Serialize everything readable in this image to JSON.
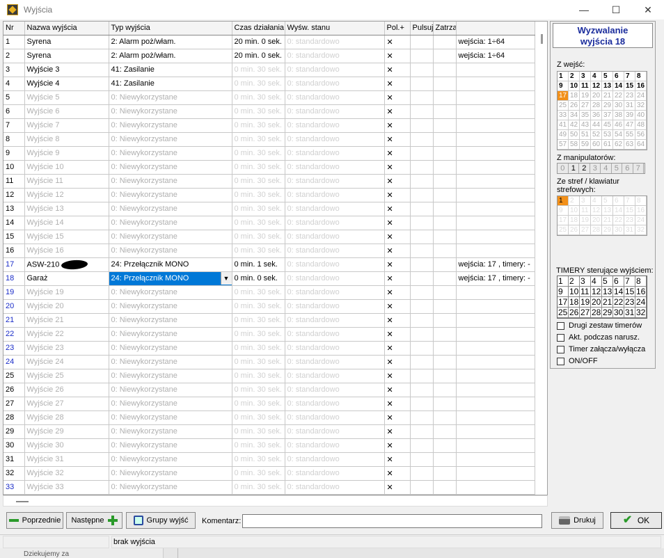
{
  "window": {
    "title": "Wyjścia",
    "minimize": "—",
    "maximize": "☐",
    "close": "✕"
  },
  "columns": [
    "Nr",
    "Nazwa wyjścia",
    "Typ wyjścia",
    "Czas działania",
    "Wyśw. stanu",
    "Pol.+",
    "Pulsuj",
    "Zatrza",
    ""
  ],
  "rows": [
    {
      "nr": "1",
      "name": "Syrena",
      "type": "2: Alarm poż/włam.",
      "time": "20 min. 0  sek.",
      "disp": "0: standardowo",
      "x": "✕",
      "info": "wejścia: 1÷64",
      "active": true
    },
    {
      "nr": "2",
      "name": "Syrena",
      "type": "2: Alarm poż/włam.",
      "time": "20 min. 0  sek.",
      "disp": "0: standardowo",
      "x": "✕",
      "info": "wejścia: 1÷64",
      "active": true
    },
    {
      "nr": "3",
      "name": "Wyjście 3",
      "type": "41: Zasilanie",
      "time": "0  min. 30 sek.",
      "disp": "0: standardowo",
      "x": "✕",
      "info": "",
      "active": true,
      "timegray": true
    },
    {
      "nr": "4",
      "name": "Wyjście 4",
      "type": "41: Zasilanie",
      "time": "0  min. 30 sek.",
      "disp": "0: standardowo",
      "x": "✕",
      "info": "",
      "active": true,
      "timegray": true
    },
    {
      "nr": "5",
      "name": "Wyjście  5",
      "type": "0: Niewykorzystane",
      "time": "0  min. 30 sek.",
      "disp": "0: standardowo",
      "x": "✕",
      "info": ""
    },
    {
      "nr": "6",
      "name": "Wyjście  6",
      "type": "0: Niewykorzystane",
      "time": "0  min. 30 sek.",
      "disp": "0: standardowo",
      "x": "✕",
      "info": ""
    },
    {
      "nr": "7",
      "name": "Wyjście  7",
      "type": "0: Niewykorzystane",
      "time": "0  min. 30 sek.",
      "disp": "0: standardowo",
      "x": "✕",
      "info": ""
    },
    {
      "nr": "8",
      "name": "Wyjście  8",
      "type": "0: Niewykorzystane",
      "time": "0  min. 30 sek.",
      "disp": "0: standardowo",
      "x": "✕",
      "info": ""
    },
    {
      "nr": "9",
      "name": "Wyjście  9",
      "type": "0: Niewykorzystane",
      "time": "0  min. 30 sek.",
      "disp": "0: standardowo",
      "x": "✕",
      "info": ""
    },
    {
      "nr": "10",
      "name": "Wyjście  10",
      "type": "0: Niewykorzystane",
      "time": "0  min. 30 sek.",
      "disp": "0: standardowo",
      "x": "✕",
      "info": ""
    },
    {
      "nr": "11",
      "name": "Wyjście  11",
      "type": "0: Niewykorzystane",
      "time": "0  min. 30 sek.",
      "disp": "0: standardowo",
      "x": "✕",
      "info": ""
    },
    {
      "nr": "12",
      "name": "Wyjście  12",
      "type": "0: Niewykorzystane",
      "time": "0  min. 30 sek.",
      "disp": "0: standardowo",
      "x": "✕",
      "info": ""
    },
    {
      "nr": "13",
      "name": "Wyjście  13",
      "type": "0: Niewykorzystane",
      "time": "0  min. 30 sek.",
      "disp": "0: standardowo",
      "x": "✕",
      "info": ""
    },
    {
      "nr": "14",
      "name": "Wyjście  14",
      "type": "0: Niewykorzystane",
      "time": "0  min. 30 sek.",
      "disp": "0: standardowo",
      "x": "✕",
      "info": ""
    },
    {
      "nr": "15",
      "name": "Wyjście  15",
      "type": "0: Niewykorzystane",
      "time": "0  min. 30 sek.",
      "disp": "0: standardowo",
      "x": "✕",
      "info": ""
    },
    {
      "nr": "16",
      "name": "Wyjście  16",
      "type": "0: Niewykorzystane",
      "time": "0  min. 30 sek.",
      "disp": "0: standardowo",
      "x": "✕",
      "info": ""
    },
    {
      "nr": "17",
      "name": "ASW-210",
      "type": "24: Przełącznik MONO",
      "time": "0  min. 1  sek.",
      "disp": "0: standardowo",
      "x": "✕",
      "info": "wejścia: 17 , timery: -",
      "active": true,
      "blue": true,
      "blob": true
    },
    {
      "nr": "18",
      "name": "Garaż",
      "type": "24: Przełącznik MONO",
      "time": "0  min. 0  sek.",
      "disp": "0: standardowo",
      "x": "✕",
      "info": "wejścia: 17 , timery: -",
      "active": true,
      "blue": true,
      "norm": true,
      "selected": true
    },
    {
      "nr": "19",
      "name": "Wyjście  19",
      "type": "0: Niewykorzystane",
      "time": "0  min. 30 sek.",
      "disp": "0: standardowo",
      "x": "✕",
      "info": "",
      "blue": true,
      "norm": true
    },
    {
      "nr": "20",
      "name": "Wyjście  20",
      "type": "0: Niewykorzystane",
      "time": "0  min. 30 sek.",
      "disp": "0: standardowo",
      "x": "✕",
      "info": "",
      "blue": true,
      "norm": true
    },
    {
      "nr": "21",
      "name": "Wyjście  21",
      "type": "0: Niewykorzystane",
      "time": "0  min. 30 sek.",
      "disp": "0: standardowo",
      "x": "✕",
      "info": "",
      "blue": true,
      "norm": true
    },
    {
      "nr": "22",
      "name": "Wyjście  22",
      "type": "0: Niewykorzystane",
      "time": "0  min. 30 sek.",
      "disp": "0: standardowo",
      "x": "✕",
      "info": "",
      "blue": true,
      "norm": true
    },
    {
      "nr": "23",
      "name": "Wyjście  23",
      "type": "0: Niewykorzystane",
      "time": "0  min. 30 sek.",
      "disp": "0: standardowo",
      "x": "✕",
      "info": "",
      "blue": true,
      "norm": true
    },
    {
      "nr": "24",
      "name": "Wyjście  24",
      "type": "0: Niewykorzystane",
      "time": "0  min. 30 sek.",
      "disp": "0: standardowo",
      "x": "✕",
      "info": "",
      "blue": true,
      "norm": true
    },
    {
      "nr": "25",
      "name": "Wyjście  25",
      "type": "0: Niewykorzystane",
      "time": "0  min. 30 sek.",
      "disp": "0: standardowo",
      "x": "✕",
      "info": "",
      "norm": true
    },
    {
      "nr": "26",
      "name": "Wyjście  26",
      "type": "0: Niewykorzystane",
      "time": "0  min. 30 sek.",
      "disp": "0: standardowo",
      "x": "✕",
      "info": "",
      "norm": true
    },
    {
      "nr": "27",
      "name": "Wyjście  27",
      "type": "0: Niewykorzystane",
      "time": "0  min. 30 sek.",
      "disp": "0: standardowo",
      "x": "✕",
      "info": "",
      "norm": true
    },
    {
      "nr": "28",
      "name": "Wyjście  28",
      "type": "0: Niewykorzystane",
      "time": "0  min. 30 sek.",
      "disp": "0: standardowo",
      "x": "✕",
      "info": "",
      "norm": true
    },
    {
      "nr": "29",
      "name": "Wyjście  29",
      "type": "0: Niewykorzystane",
      "time": "0  min. 30 sek.",
      "disp": "0: standardowo",
      "x": "✕",
      "info": "",
      "norm": true
    },
    {
      "nr": "30",
      "name": "Wyjście  30",
      "type": "0: Niewykorzystane",
      "time": "0  min. 30 sek.",
      "disp": "0: standardowo",
      "x": "✕",
      "info": "",
      "norm": true
    },
    {
      "nr": "31",
      "name": "Wyjście  31",
      "type": "0: Niewykorzystane",
      "time": "0  min. 30 sek.",
      "disp": "0: standardowo",
      "x": "✕",
      "info": "",
      "norm": true
    },
    {
      "nr": "32",
      "name": "Wyjście  32",
      "type": "0: Niewykorzystane",
      "time": "0  min. 30 sek.",
      "disp": "0: standardowo",
      "x": "✕",
      "info": "",
      "norm": true
    },
    {
      "nr": "33",
      "name": "Wyjście  33",
      "type": "0: Niewykorzystane",
      "time": "0  min. 30 sek.",
      "disp": "0: standardowo",
      "x": "✕",
      "info": "",
      "blue": true,
      "norm": true
    }
  ],
  "right_panel": {
    "title_line1": "Wyzwalanie",
    "title_line2": "wyjścia 18",
    "inputs_label": "Z wejść:",
    "inputs_selected": "17",
    "keypads_label": "Z manipulatorów:",
    "keypads": [
      "0",
      "1",
      "2",
      "3",
      "4",
      "5",
      "6",
      "7"
    ],
    "zones_label_line1": "Ze stref / klawiatur",
    "zones_label_line2": "strefowych:",
    "timers_label": "TIMERY sterujące wyjściem:",
    "checkboxes": [
      "Drugi zestaw timerów",
      "Akt. podczas narusz.",
      "Timer załącza/wyłącza",
      "ON/OFF"
    ]
  },
  "buttons": {
    "prev": "Poprzednie",
    "next": "Następne",
    "groups": "Grupy wyjść",
    "comment_label": "Komentarz:",
    "print": "Drukuj",
    "ok": "OK"
  },
  "status": {
    "text": "brak wyjścia"
  },
  "background": {
    "text": "Dziekujemy za"
  },
  "colors": {
    "selection": "#0078d7",
    "highlight": "#f29019",
    "title_blue": "#1a2c9c"
  }
}
